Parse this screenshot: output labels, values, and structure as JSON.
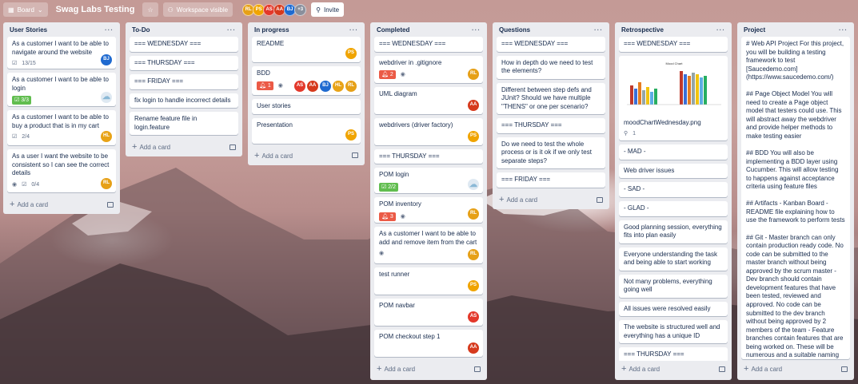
{
  "header": {
    "view_label": "Board",
    "title": "Swag Labs Testing",
    "visibility_label": "Workspace visible",
    "members": [
      {
        "initials": "RL",
        "color": "#e6a017"
      },
      {
        "initials": "PS",
        "color": "#f0a400"
      },
      {
        "initials": "AS",
        "color": "#e3382b"
      },
      {
        "initials": "AA",
        "color": "#d63a1d"
      },
      {
        "initials": "BJ",
        "color": "#1f6ad0"
      }
    ],
    "more_members": "+3",
    "invite_label": "Invite"
  },
  "add_card_label": "Add a card",
  "lists": {
    "user_stories": {
      "title": "User Stories",
      "cards": [
        {
          "text": "As a customer I want to be able to navigate around the website",
          "checklist": "13/15",
          "avatar": "BJ"
        },
        {
          "text": "As a customer I want to be able to login",
          "checklist": "3/3"
        },
        {
          "text": "As a customer I want to be able to buy a product that is in my cart",
          "checklist": "2/4",
          "avatar": "HL"
        },
        {
          "text": "As a user I want the website to be consistent so I can see the correct details",
          "checklist": "0/4",
          "avatar": "RL"
        }
      ]
    },
    "todo": {
      "title": "To-Do",
      "cards": [
        "=== WEDNESDAY ===",
        "=== THURSDAY ===",
        "=== FRIDAY ===",
        "fix login to handle incorrect details",
        "Rename feature file in login.feature"
      ]
    },
    "in_progress": {
      "title": "In progress",
      "cards": [
        {
          "text": "README",
          "avatar": "PS"
        },
        {
          "text": "BDD",
          "alerts": "1",
          "avatars": [
            "AS",
            "AA",
            "BJ",
            "HL",
            "RL"
          ]
        },
        {
          "text": "User stories"
        },
        {
          "text": "Presentation",
          "avatar": "PS"
        }
      ]
    },
    "completed": {
      "title": "Completed",
      "cards": [
        {
          "text": "=== WEDNESDAY ==="
        },
        {
          "text": "webdriver in .gitignore",
          "alerts": "2",
          "avatar": "RL"
        },
        {
          "text": "UML diagram",
          "avatar": "AA"
        },
        {
          "text": "webdrivers (driver factory)",
          "avatar": "PS"
        },
        {
          "text": "=== THURSDAY ==="
        },
        {
          "text": "POM login",
          "checklist": "2/2"
        },
        {
          "text": "POM inventory",
          "alerts": "3",
          "avatar": "RL"
        },
        {
          "text": "As a customer I want to be able to add and remove item from the cart",
          "avatar": "RL"
        },
        {
          "text": "test runner",
          "avatar": "PS"
        },
        {
          "text": "POM navbar",
          "avatar": "AS"
        },
        {
          "text": "POM checkout step 1",
          "avatar": "AA"
        }
      ]
    },
    "questions": {
      "title": "Questions",
      "cards": [
        "=== WEDNESDAY ===",
        "How in depth do we need to test the elements?",
        "Different between step defs and JUnit? Should we have multiple \"THENS\" or one per scenario?",
        "=== THURSDAY ===",
        "Do we need to test the whole process or is it ok if we only test separate steps?",
        "=== FRIDAY ==="
      ]
    },
    "retrospective": {
      "title": "Retrospective",
      "attachment_title": "Mood Chart",
      "cards": [
        {
          "text": "=== WEDNESDAY ==="
        },
        {
          "text": "moodChartWednesday.png",
          "attachments": "1"
        },
        {
          "text": "- MAD -"
        },
        {
          "text": "Web driver issues"
        },
        {
          "text": "- SAD -"
        },
        {
          "text": "- GLAD -"
        },
        {
          "text": "Good planning session, everything fits into plan easily"
        },
        {
          "text": "Everyone understanding the task and being able to start working"
        },
        {
          "text": "Not many problems, everything going well"
        },
        {
          "text": "All issues were resolved easily"
        },
        {
          "text": "The website is structured well and everything has a unique ID"
        },
        {
          "text": "=== THURSDAY ==="
        }
      ]
    },
    "project": {
      "title": "Project",
      "description": "# Web API Project For this project, you will be building a testing framework to test [Saucedemo.com](https://www.saucedemo.com/)\n\n## Page Object Model You will need to create a Page object model that testers could use. This will abstract away the webdriver and provide helper methods to make testing easier\n\n## BDD You will also be implementing a BDD layer using Cucumber. This will allow testing to happens against acceptance criteria using feature files\n\n## Artifacts - Kanban Board - README file explaining how to use the framework to perform tests\n\n## Git - Master branch can only contain production ready code. No code can be submitted to the master branch without being approved by the scrum master - Dev branch should contain development features that have been tested, reviewed and approved. No code can be submitted to the dev branch without being approved by 2 members of the team - Feature branches contain features that are being worked on. These will be numerous and a suitable naming strategy needs to be used. Aim to have a branch for each feature you"
    }
  },
  "avatar_colors": {
    "RL": "#e6a017",
    "PS": "#f0a400",
    "AS": "#e3382b",
    "AA": "#d63a1d",
    "BJ": "#1f6ad0",
    "HL": "#e8a317"
  }
}
